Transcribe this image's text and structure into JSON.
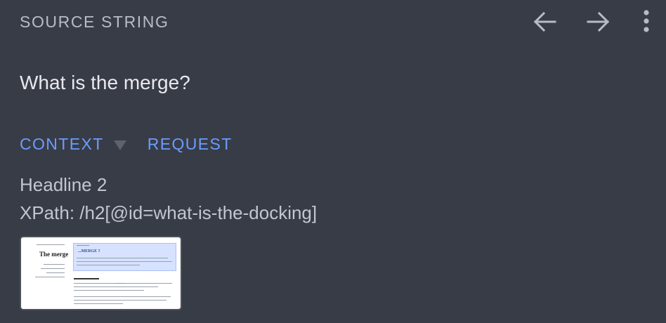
{
  "header": {
    "title": "SOURCE STRING",
    "actions": [
      {
        "icon": "arrow-left-icon"
      },
      {
        "icon": "arrow-right-icon"
      },
      {
        "icon": "more-vertical-icon"
      }
    ]
  },
  "source": {
    "text": "What is the merge?"
  },
  "tabs": {
    "context_label": "CONTEXT",
    "request_label": "REQUEST"
  },
  "context": {
    "element_type": "Headline 2",
    "xpath": "XPath: /h2[@id=what-is-the-docking]"
  },
  "screenshot_thumbnail": {
    "heading_text": "The merge",
    "highlight_text": "...MERGE ?"
  },
  "colors": {
    "background": "#383c47",
    "accent": "#6b9cff",
    "text_primary": "#e8e9ee",
    "text_secondary": "#c3c6cf"
  }
}
